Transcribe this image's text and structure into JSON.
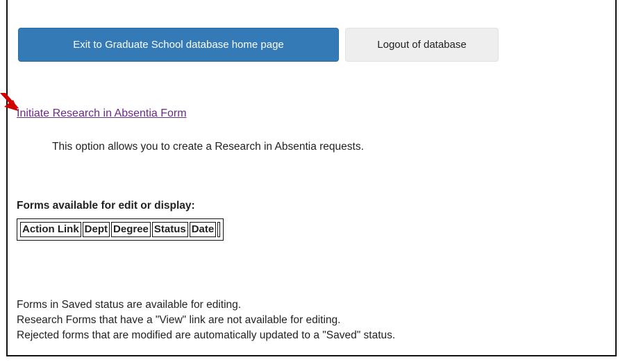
{
  "buttons": {
    "exit_label": "Exit to Graduate School database home page",
    "logout_label": "Logout of database"
  },
  "initiate": {
    "link_text": "Initiate Research in Absentia Form",
    "description": "This option allows you to create a Research in Absentia requests."
  },
  "forms": {
    "heading": "Forms available for edit or display:",
    "columns": [
      "Action Link",
      "Dept",
      "Degree",
      "Status",
      "Date"
    ]
  },
  "notes": [
    "Forms in Saved status are available for editing.",
    "Research Forms that have a \"View\" link are not available for editing.",
    "Rejected forms that are modified are automatically updated to a \"Saved\" status."
  ],
  "colors": {
    "primary": "#337ab7",
    "link": "#6a2a8a",
    "arrow": "#d10000"
  },
  "icons": {
    "annotation": "red-arrow-icon"
  }
}
